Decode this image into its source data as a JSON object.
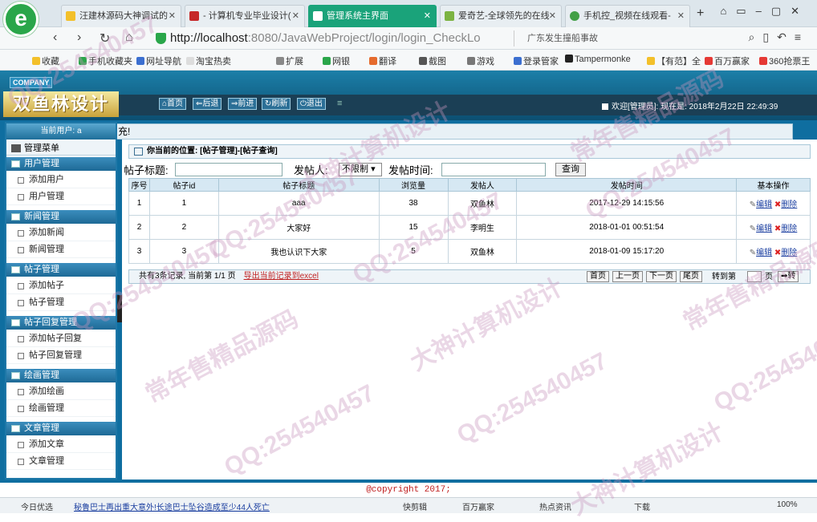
{
  "browser": {
    "logo_glyph": "e",
    "tabs": [
      {
        "label": "汪建林源码大神调试的"
      },
      {
        "label": "- 计算机专业毕业设计("
      },
      {
        "label": "管理系统主界面"
      },
      {
        "label": "爱奇艺-全球领先的在线"
      },
      {
        "label": "手机控_视频在线观看-"
      }
    ],
    "new_tab": "+",
    "url_host": "http://localhost",
    "url_path": ":8080/JavaWebProject/login/login_CheckLo",
    "search_text": "广东发生撞船事故",
    "bookmarks": [
      "收藏",
      "手机收藏夹",
      "网址导航",
      "淘宝热卖",
      "扩展",
      "网银",
      "翻译",
      "截图",
      "游戏",
      "登录管家",
      "Tampermonke",
      "【有范】全",
      "百万赢家",
      "360抢票王"
    ]
  },
  "app": {
    "company": "COMPANY",
    "brand": "双鱼林设计",
    "nav": [
      {
        "label": "首页"
      },
      {
        "label": "后退"
      },
      {
        "label": "前进"
      },
      {
        "label": "刷新"
      },
      {
        "label": "退出"
      }
    ],
    "welcome": "欢迎[管理员]:  现在是: 2018年2月22日 22:49:39",
    "notice": "充!",
    "current_user": "当前用户: a",
    "menu_title": "管理菜单",
    "groups": [
      {
        "label": "用户管理",
        "items": [
          "添加用户",
          "用户管理"
        ]
      },
      {
        "label": "新闻管理",
        "items": [
          "添加新闻",
          "新闻管理"
        ]
      },
      {
        "label": "帖子管理",
        "items": [
          "添加帖子",
          "帖子管理"
        ]
      },
      {
        "label": "帖子回复管理",
        "items": [
          "添加帖子回复",
          "帖子回复管理"
        ]
      },
      {
        "label": "绘画管理",
        "items": [
          "添加绘画",
          "绘画管理"
        ]
      },
      {
        "label": "文章管理",
        "items": [
          "添加文章",
          "文章管理"
        ]
      }
    ]
  },
  "main": {
    "location": "你当前的位置: [帖子管理]-[帖子查询]",
    "filter": {
      "title_label": "帖子标题:",
      "poster_label": "发帖人:",
      "poster_value": "不限制",
      "time_label": "发帖时间:",
      "query_button": "查询"
    },
    "columns": [
      "序号",
      "帖子id",
      "帖子标题",
      "浏览量",
      "发帖人",
      "发帖时间",
      "基本操作"
    ],
    "rows": [
      [
        "1",
        "1",
        "aaa",
        "38",
        "双鱼林",
        "2017-12-29 14:15:56"
      ],
      [
        "2",
        "2",
        "大家好",
        "15",
        "李明生",
        "2018-01-01 00:51:54"
      ],
      [
        "3",
        "3",
        "我也认识下大家",
        "5",
        "双鱼林",
        "2018-01-09 15:17:20"
      ]
    ],
    "edit_label": "编辑",
    "delete_label": "删除",
    "footer": {
      "summary": "共有3条记录, 当前第 1/1 页",
      "export": "导出当前记录到excel",
      "first": "首页",
      "prev": "上一页",
      "next": "下一页",
      "last": "尾页",
      "goto_label": "转到第",
      "page_unit": "页",
      "go": "转"
    }
  },
  "copyright": "@copyright 2017;",
  "statusbar": {
    "left": "今日优选",
    "news": "秘鲁巴士再出重大意外!长途巴士坠谷造成至少44人死亡",
    "tools": [
      "快剪辑",
      "百万赢家",
      "热点资讯",
      "下载",
      "100%"
    ]
  },
  "watermarks": [
    "QQ:254540457",
    "常年售精品源码",
    "大神计算机设计"
  ]
}
